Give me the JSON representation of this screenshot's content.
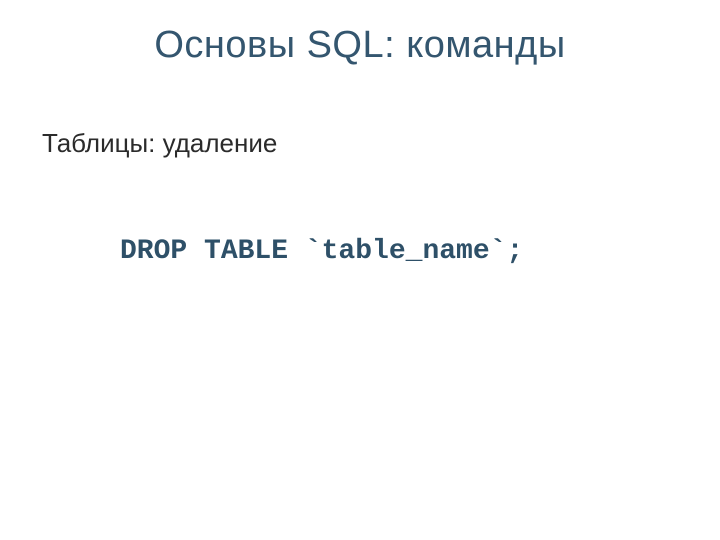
{
  "title": "Основы SQL: команды",
  "subheading": "Таблицы: удаление",
  "code": "DROP TABLE `table_name`;"
}
